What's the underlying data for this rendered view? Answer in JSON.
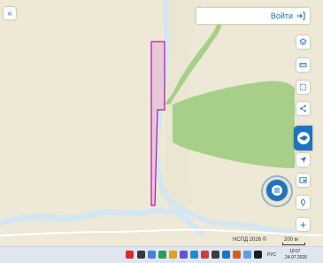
{
  "map": {
    "colors": {
      "base": "#ede9d6",
      "field": "#a7cf8a",
      "river": "#d4e6f3",
      "parcel_fill": "#e6c9d9",
      "parcel_stroke": "#b218a4",
      "road": "#ffffff"
    },
    "copyright": "НСПД 2026 ©",
    "scale": "200 м"
  },
  "controls": {
    "login_label": "Войти",
    "collapse_icon": "double-chevron-left-icon",
    "right_toolbar": [
      "layers-icon",
      "ruler-icon",
      "select-area-icon",
      "share-icon",
      "brand-logo-icon",
      "locate-icon",
      "export-icon",
      "location-marker-icon",
      "zoom-in-icon"
    ],
    "fab_icon": "menu-list-icon"
  },
  "taskbar": {
    "lang": "РУС",
    "time": "10:07",
    "date": "24.07.2026"
  }
}
